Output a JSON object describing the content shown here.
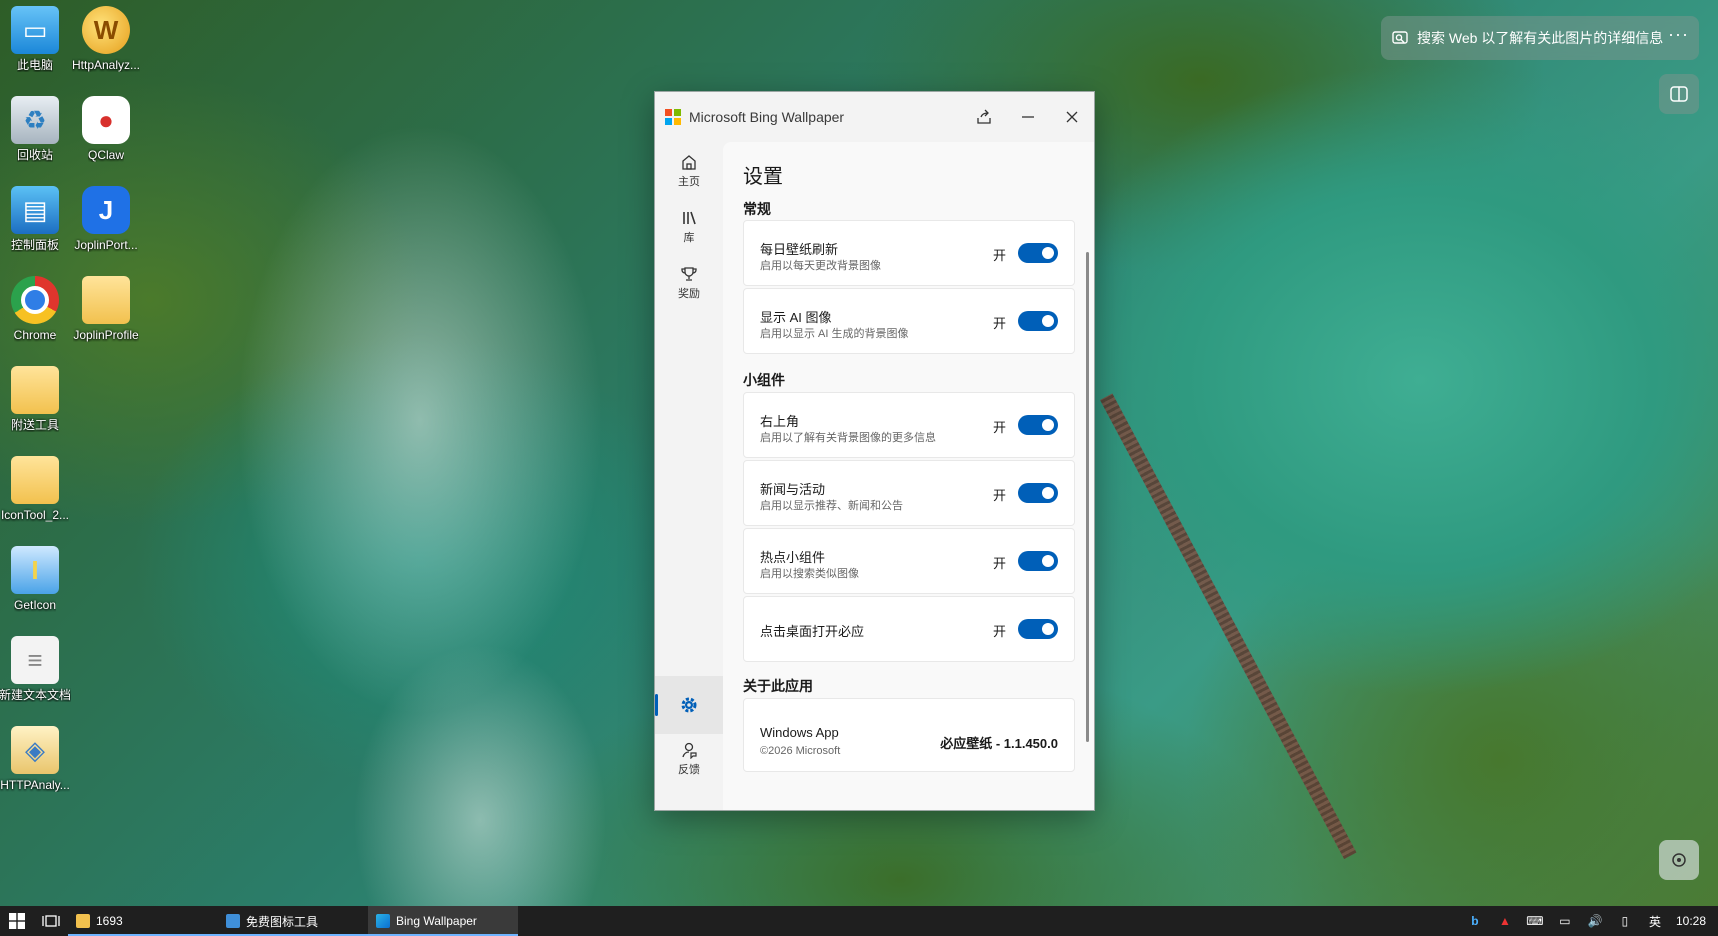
{
  "desktop": {
    "icons": [
      {
        "label": "此电脑"
      },
      {
        "label": "HttpAnalyz..."
      },
      {
        "label": "回收站"
      },
      {
        "label": "QClaw"
      },
      {
        "label": "控制面板"
      },
      {
        "label": "JoplinPort..."
      },
      {
        "label": "Chrome"
      },
      {
        "label": "JoplinProfile"
      },
      {
        "label": "附送工具"
      },
      {
        "label": "IconTool_2..."
      },
      {
        "label": "GetIcon"
      },
      {
        "label": "新建文本文档"
      },
      {
        "label": "HTTPAnaly..."
      }
    ],
    "search_text": "搜索 Web 以了解有关此图片的详细信息",
    "more_glyph": "···"
  },
  "window": {
    "title": "Microsoft Bing Wallpaper",
    "nav": {
      "home": "主页",
      "library": "库",
      "rewards": "奖励",
      "feedback": "反馈"
    },
    "page_title": "设置",
    "sections": {
      "general": "常规",
      "widgets": "小组件",
      "about": "关于此应用"
    },
    "settings": [
      {
        "title": "每日壁纸刷新",
        "desc": "启用以每天更改背景图像",
        "state": "开"
      },
      {
        "title": "显示 AI 图像",
        "desc": "启用以显示 AI 生成的背景图像",
        "state": "开"
      },
      {
        "title": "右上角",
        "desc": "启用以了解有关背景图像的更多信息",
        "state": "开"
      },
      {
        "title": "新闻与活动",
        "desc": "启用以显示推荐、新闻和公告",
        "state": "开"
      },
      {
        "title": "热点小组件",
        "desc": "启用以搜索类似图像",
        "state": "开"
      },
      {
        "title": "点击桌面打开必应",
        "desc": "",
        "state": "开"
      }
    ],
    "about": {
      "title": "Windows App",
      "copyright": "©2026 Microsoft",
      "version": "必应壁纸 - 1.1.450.0"
    }
  },
  "taskbar": {
    "apps": [
      {
        "label": "1693"
      },
      {
        "label": "免费图标工具"
      },
      {
        "label": "Bing Wallpaper"
      }
    ],
    "ime": "英",
    "clock": "10:28"
  },
  "colors": {
    "accent": "#005fb8",
    "taskbar": "#1f1f1f",
    "window_bg": "#f3f3f3"
  }
}
